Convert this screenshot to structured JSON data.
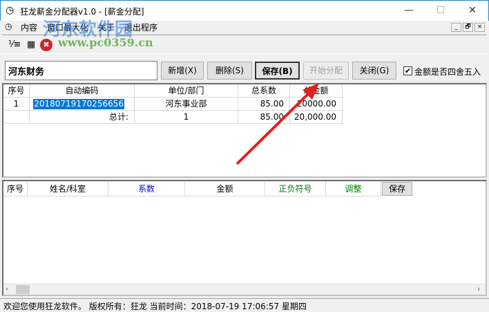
{
  "window": {
    "title": "狂龙薪金分配器v1.0 - [薪金分配]",
    "min": "—",
    "max": "☐",
    "close": "✕"
  },
  "menu": [
    "内容",
    "窗口最大化",
    "关于",
    "退出程序"
  ],
  "mdi": [
    "_",
    "🗗",
    "×"
  ],
  "toolbar": {
    "icons": [
      "assign-icon",
      "calculator-icon",
      "delete-icon"
    ]
  },
  "form": {
    "name_value": "河东财务",
    "buttons": {
      "add": "新增(X)",
      "delete": "删除(S)",
      "save": "保存(B)",
      "start": "开始分配",
      "close": "关闭(G)"
    },
    "round_label": "金额是否四舍五入",
    "round_checked": true
  },
  "grid1": {
    "headers": [
      "序号",
      "自动编码",
      "单位/部门",
      "总系数",
      "总金额"
    ],
    "rows": [
      [
        "1",
        "20180719170256656",
        "河东事业部",
        "85.00",
        "20000.00"
      ]
    ],
    "total": {
      "label": "总计:",
      "count": "1",
      "coef": "85.00",
      "amount": "20,000.00"
    }
  },
  "grid2": {
    "headers": [
      "序号",
      "姓名/科室",
      "系数",
      "金额",
      "正负符号",
      "调整"
    ],
    "save_label": "保存"
  },
  "status": "欢迎您使用狂龙软件。 版权所有：狂龙   当前时间：2018-07-19 17:06:57  星期四",
  "watermark": {
    "name": "河东软件园",
    "url": "www.pc0359.cn"
  }
}
